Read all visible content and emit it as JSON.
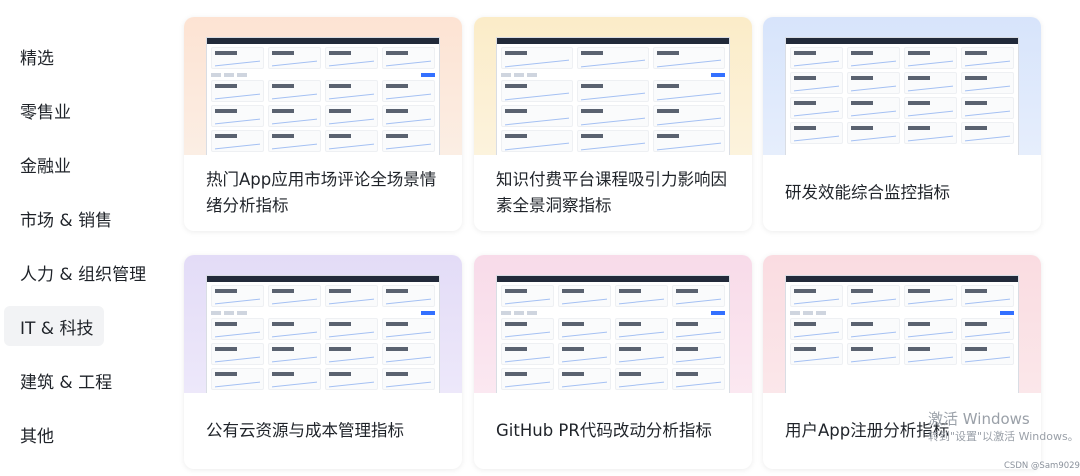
{
  "sidebar": {
    "items": [
      {
        "label": "精选",
        "active": false
      },
      {
        "label": "零售业",
        "active": false
      },
      {
        "label": "金融业",
        "active": false
      },
      {
        "label": "市场 & 销售",
        "active": false
      },
      {
        "label": "人力 & 组织管理",
        "active": false
      },
      {
        "label": "IT & 科技",
        "active": true
      },
      {
        "label": "建筑 & 工程",
        "active": false
      },
      {
        "label": "其他",
        "active": false
      }
    ]
  },
  "cards": [
    {
      "title": "热门App应用市场评论全场景情绪分析指标",
      "theme": "peach"
    },
    {
      "title": "知识付费平台课程吸引力影响因素全景洞察指标",
      "theme": "yellow"
    },
    {
      "title": "研发效能综合监控指标",
      "theme": "blue"
    },
    {
      "title": "公有云资源与成本管理指标",
      "theme": "lavender"
    },
    {
      "title": "GitHub PR代码改动分析指标",
      "theme": "pink"
    },
    {
      "title": "用户App注册分析指标",
      "theme": "rose"
    }
  ],
  "overlay": {
    "watermark_title": "激活 Windows",
    "watermark_sub": "转到\"设置\"以激活 Windows。",
    "credit": "CSDN @Sam9029"
  },
  "colors": {
    "accent": "#3370ff",
    "active_bg": "#f2f3f5",
    "text": "#1f2329"
  }
}
